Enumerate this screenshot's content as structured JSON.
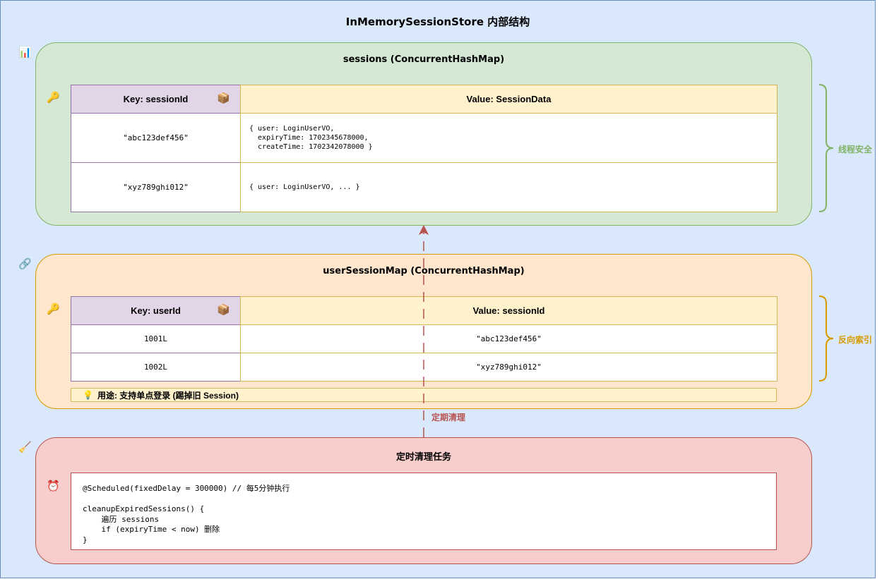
{
  "title": "InMemorySessionStore 内部结构",
  "colors": {
    "canvas_bg": "#dae8fc",
    "green": "#82b366",
    "orange": "#d79b00",
    "red_edge": "#b85450"
  },
  "sessions": {
    "title": "sessions (ConcurrentHashMap)",
    "icon": "bar-chart-icon",
    "key_header": "Key: sessionId",
    "value_header": "Value: SessionData",
    "rows": [
      {
        "key": "\"abc123def456\"",
        "value": "{ user: LoginUserVO,\n  expiryTime: 1702345678000,\n  createTime: 1702342078000 }"
      },
      {
        "key": "\"xyz789ghi012\"",
        "value": "{ user: LoginUserVO, ... }"
      }
    ],
    "side_label": "线程安全"
  },
  "user_session_map": {
    "title": "userSessionMap (ConcurrentHashMap)",
    "icon": "link-icon",
    "key_header": "Key: userId",
    "value_header": "Value: sessionId",
    "rows": [
      {
        "key": "1001L",
        "value": "\"abc123def456\""
      },
      {
        "key": "1002L",
        "value": "\"xyz789ghi012\""
      }
    ],
    "usage": "用途: 支持单点登录 (踢掉旧 Session)",
    "side_label": "反向索引"
  },
  "cleanup": {
    "title": "定时清理任务",
    "icon": "broom-icon",
    "code": "@Scheduled(fixedDelay = 300000) // 每5分钟执行\n\ncleanupExpiredSessions() {\n    遍历 sessions\n    if (expiryTime < now) 删除\n}",
    "edge_label": "定期清理"
  }
}
